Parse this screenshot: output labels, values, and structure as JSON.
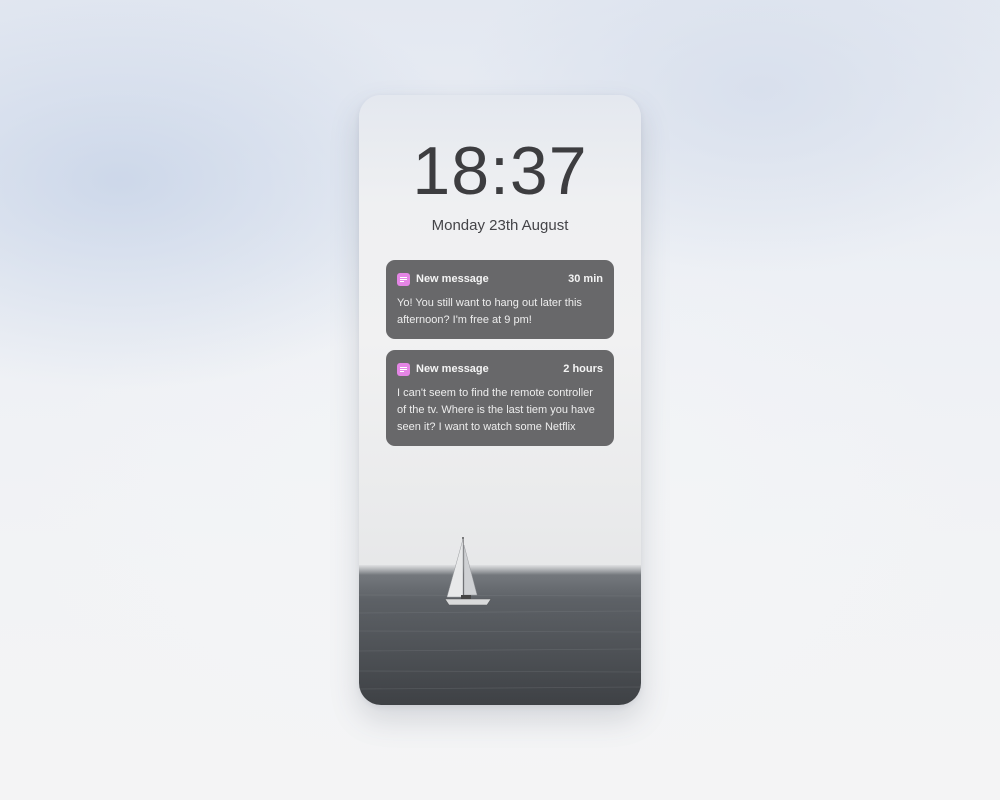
{
  "lockscreen": {
    "time": "18:37",
    "date": "Monday 23th August"
  },
  "notifications": [
    {
      "app_icon": "message-icon",
      "title": "New message",
      "time": "30 min",
      "body": "Yo! You still want to hang out later this afternoon? I'm free at 9 pm!"
    },
    {
      "app_icon": "message-icon",
      "title": "New message",
      "time": "2 hours",
      "body": "I can't seem to find the remote controller of the tv. Where is the last tiem you have seen it? I want to watch some Netflix"
    }
  ],
  "colors": {
    "app_icon": "#e586e6",
    "notification_bg": "#5c5c5e",
    "clock_text": "#3d3d40"
  }
}
